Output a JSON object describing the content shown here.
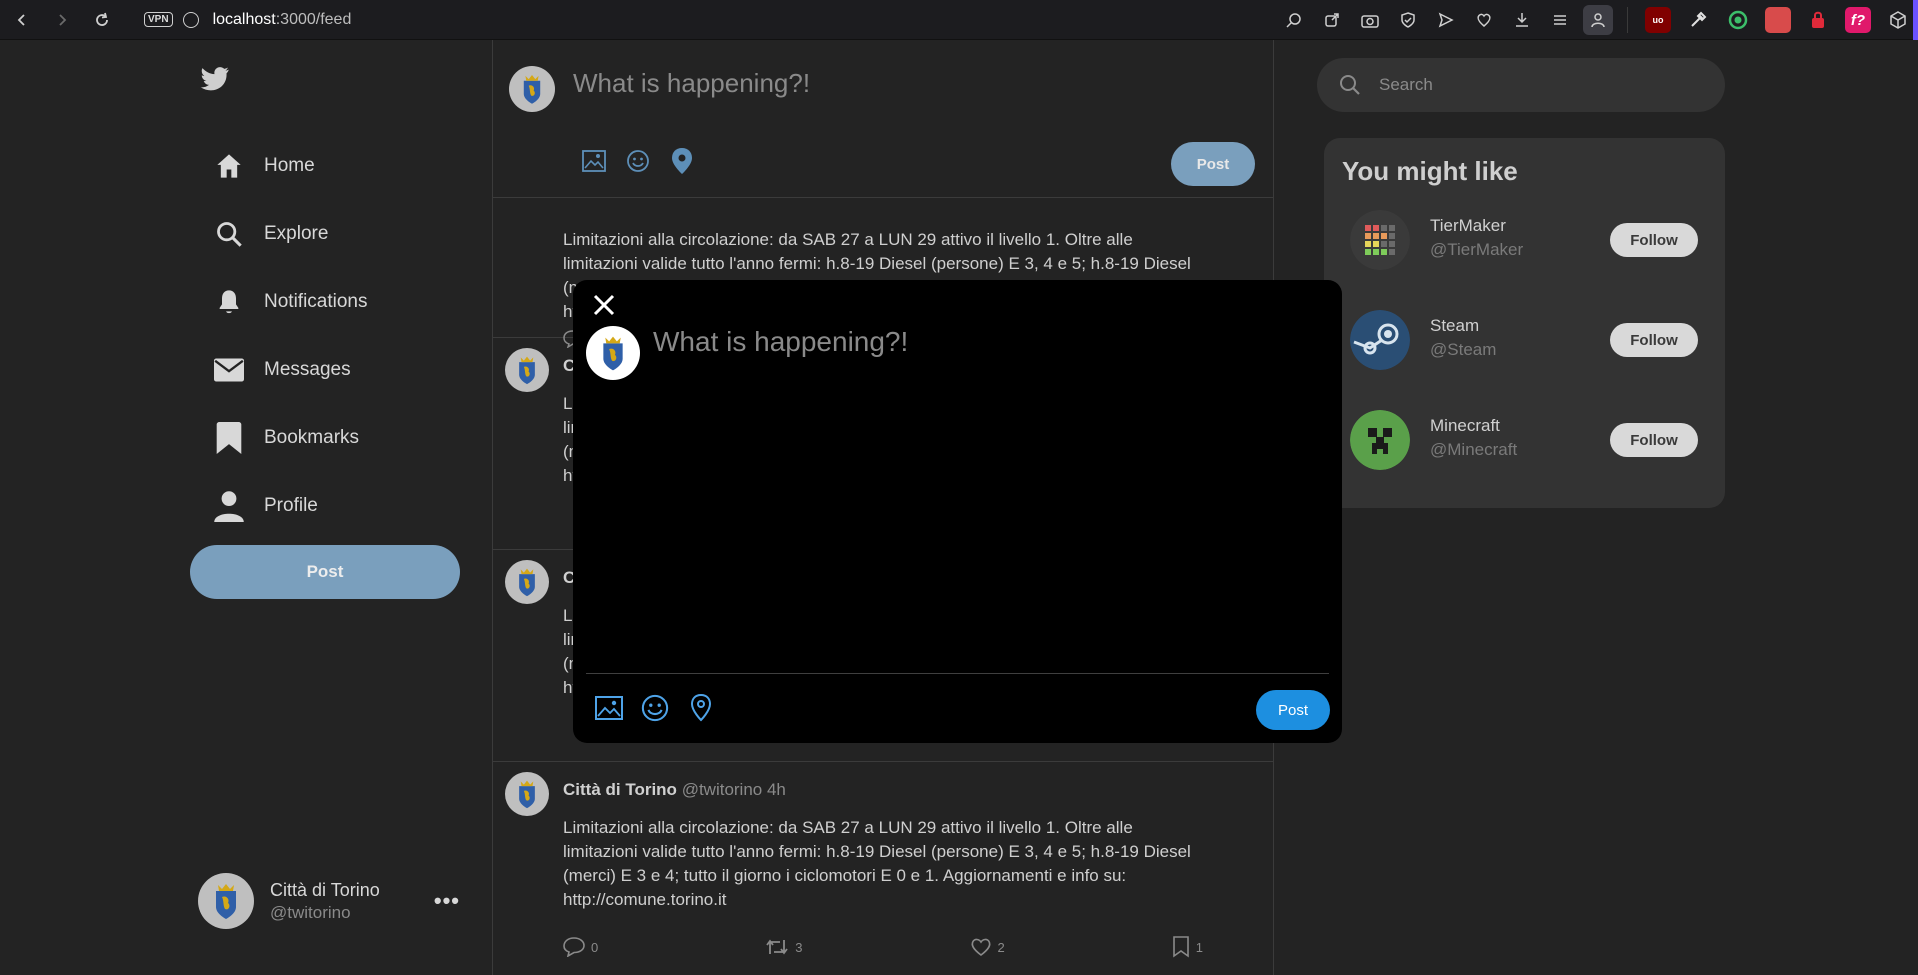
{
  "browser": {
    "url_host": "localhost",
    "url_path": ":3000/feed",
    "vpn_label": "VPN"
  },
  "sidebar": {
    "items": [
      {
        "label": "Home",
        "icon": "home-icon"
      },
      {
        "label": "Explore",
        "icon": "search-icon"
      },
      {
        "label": "Notifications",
        "icon": "bell-icon"
      },
      {
        "label": "Messages",
        "icon": "mail-icon"
      },
      {
        "label": "Bookmarks",
        "icon": "bookmark-icon"
      },
      {
        "label": "Profile",
        "icon": "user-icon"
      }
    ],
    "post_label": "Post",
    "account": {
      "name": "Città di Torino",
      "handle": "@twitorino"
    }
  },
  "composer": {
    "placeholder": "What is happening?!",
    "post_label": "Post"
  },
  "tweets": [
    {
      "name": "Città di Torino",
      "meta": "@twitorino 4h",
      "partial_first": "C",
      "body": "Limitazioni alla circolazione: da SAB 27 a LUN 29 attivo il livello 1. Oltre alle limitazioni valide tutto l'anno fermi: h.8-19 Diesel (persone) E 3, 4 e 5; h.8-19 Diesel (merci) E 3 e 4; tutto il giorno i ciclomotori E 0 e 1. Aggiornamenti e info su: http://comune.torino.it",
      "replies": "0",
      "retweets": "3",
      "likes": "2",
      "bookmarks": "1"
    }
  ],
  "search": {
    "placeholder": "Search"
  },
  "suggestions": {
    "title": "You might like",
    "follow_label": "Follow",
    "items": [
      {
        "name": "TierMaker",
        "handle": "@TierMaker"
      },
      {
        "name": "Steam",
        "handle": "@Steam"
      },
      {
        "name": "Minecraft",
        "handle": "@Minecraft"
      }
    ]
  },
  "modal": {
    "placeholder": "What is happening?!",
    "post_label": "Post"
  },
  "colors": {
    "accent": "#1d8fe0",
    "accent_muted": "#7a9fbd",
    "background": "#232323",
    "panel": "#333333"
  }
}
